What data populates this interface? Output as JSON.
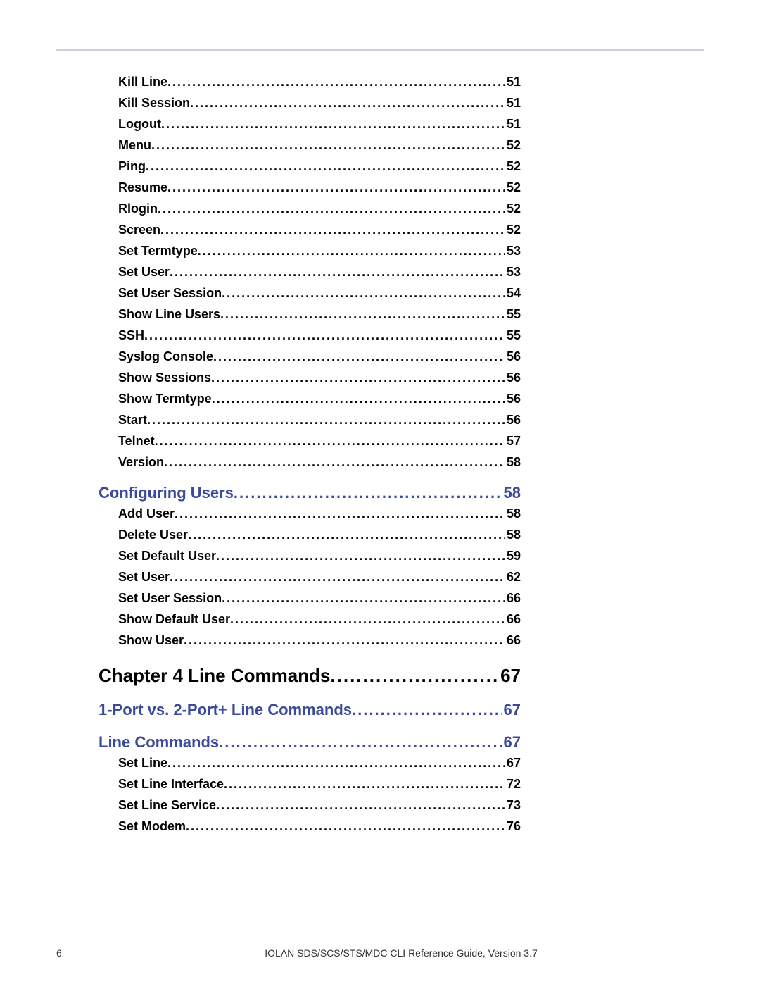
{
  "footer": {
    "page_number": "6",
    "title": "IOLAN SDS/SCS/STS/MDC CLI Reference Guide, Version 3.7"
  },
  "toc": [
    {
      "label": "Kill Line",
      "page": "51",
      "level": 2
    },
    {
      "label": "Kill Session",
      "page": "51",
      "level": 2
    },
    {
      "label": "Logout",
      "page": "51",
      "level": 2
    },
    {
      "label": "Menu",
      "page": "52",
      "level": 2
    },
    {
      "label": "Ping",
      "page": "52",
      "level": 2
    },
    {
      "label": "Resume",
      "page": "52",
      "level": 2
    },
    {
      "label": "Rlogin",
      "page": "52",
      "level": 2
    },
    {
      "label": "Screen",
      "page": "52",
      "level": 2
    },
    {
      "label": "Set Termtype",
      "page": "53",
      "level": 2
    },
    {
      "label": "Set User",
      "page": "53",
      "level": 2
    },
    {
      "label": "Set User Session",
      "page": "54",
      "level": 2
    },
    {
      "label": "Show Line Users",
      "page": "55",
      "level": 2
    },
    {
      "label": "SSH",
      "page": "55",
      "level": 2
    },
    {
      "label": "Syslog Console",
      "page": "56",
      "level": 2
    },
    {
      "label": "Show Sessions",
      "page": "56",
      "level": 2
    },
    {
      "label": "Show Termtype",
      "page": "56",
      "level": 2
    },
    {
      "label": "Start",
      "page": "56",
      "level": 2
    },
    {
      "label": "Telnet",
      "page": "57",
      "level": 2
    },
    {
      "label": "Version",
      "page": "58",
      "level": 2
    },
    {
      "label": "Configuring Users",
      "page": "58",
      "level": 1
    },
    {
      "label": "Add User",
      "page": "58",
      "level": 2
    },
    {
      "label": "Delete User",
      "page": "58",
      "level": 2
    },
    {
      "label": "Set Default User",
      "page": "59",
      "level": 2
    },
    {
      "label": "Set User",
      "page": "62",
      "level": 2
    },
    {
      "label": "Set User Session",
      "page": "66",
      "level": 2
    },
    {
      "label": "Show Default User",
      "page": "66",
      "level": 2
    },
    {
      "label": "Show User",
      "page": "66",
      "level": 2
    },
    {
      "label": "Chapter 4  Line Commands",
      "page": "67",
      "level": 0
    },
    {
      "label": "1-Port vs. 2-Port+ Line Commands",
      "page": "67",
      "level": 1
    },
    {
      "label": "Line Commands",
      "page": "67",
      "level": 1
    },
    {
      "label": "Set Line",
      "page": "67",
      "level": 2
    },
    {
      "label": "Set Line Interface",
      "page": "72",
      "level": 2
    },
    {
      "label": "Set Line Service",
      "page": "73",
      "level": 2
    },
    {
      "label": "Set Modem",
      "page": "76",
      "level": 2
    }
  ]
}
